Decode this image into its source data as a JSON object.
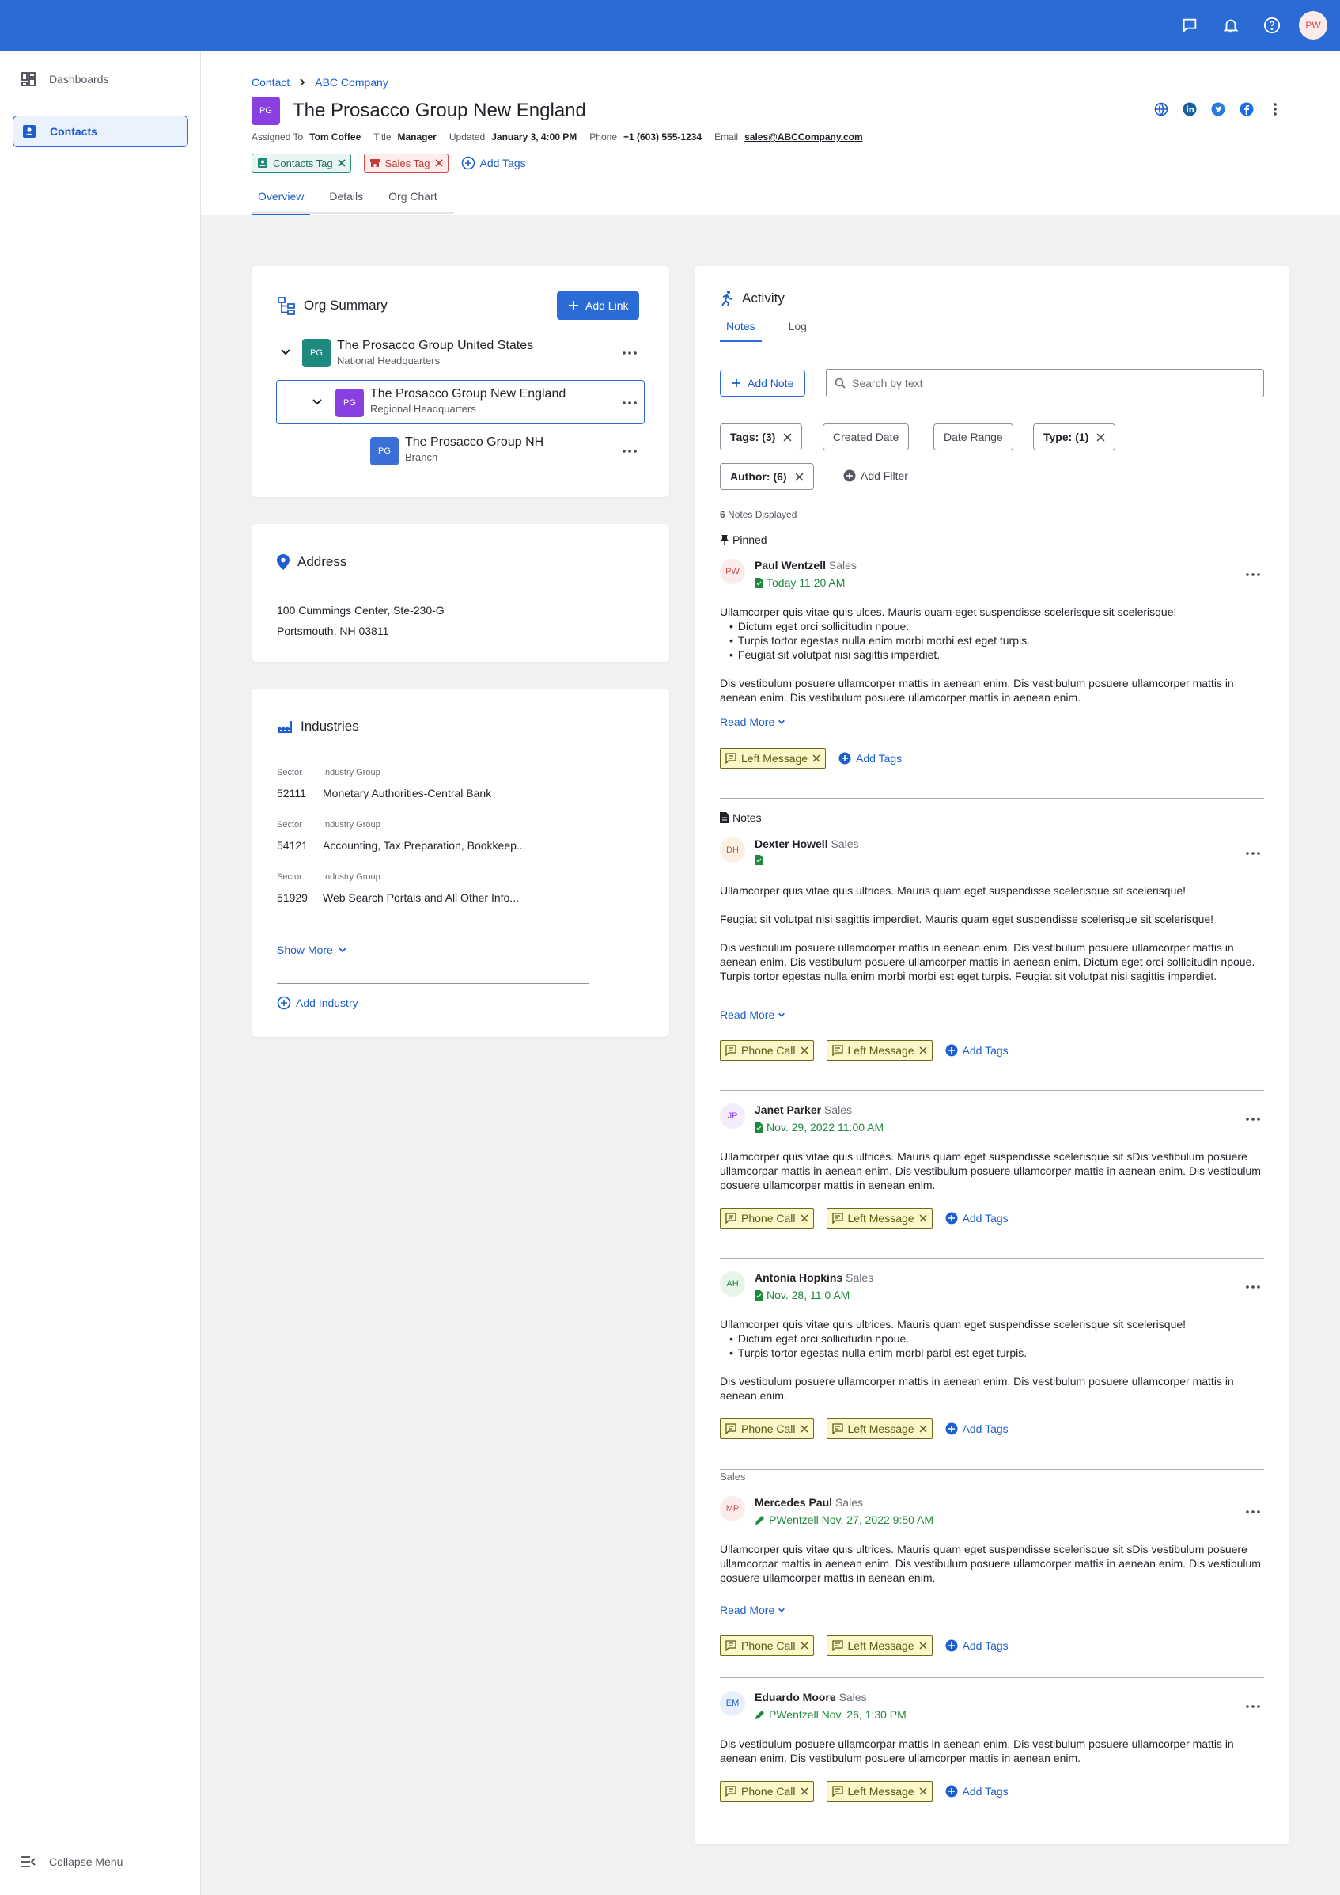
{
  "topbar": {
    "avatar_initials": "PW"
  },
  "sidebar": {
    "items": [
      {
        "label": "Dashboards"
      },
      {
        "label": "Contacts"
      }
    ],
    "collapse_label": "Collapse Menu"
  },
  "header": {
    "breadcrumb": [
      "Contact",
      "ABC Company"
    ],
    "logo_initials": "PG",
    "title": "The Prosacco Group New England",
    "meta": {
      "assigned_label": "Assigned To",
      "assigned_value": "Tom Coffee",
      "title_label": "Title",
      "title_value": "Manager",
      "updated_label": "Updated",
      "updated_value": "January 3, 4:00 PM",
      "phone_label": "Phone",
      "phone_value": "+1 (603) 555-1234",
      "email_label": "Email",
      "email_value": "sales@ABCCompany.com"
    },
    "tags": [
      "Contacts Tag",
      "Sales Tag"
    ],
    "add_tags_label": "Add Tags",
    "tabs": [
      "Overview",
      "Details",
      "Org Chart"
    ]
  },
  "org_summary": {
    "title": "Org Summary",
    "add_link_label": "Add Link",
    "rows": [
      {
        "initials": "PG",
        "name": "The Prosacco Group United States",
        "sub": "National Headquarters",
        "color": "#1e8a7d"
      },
      {
        "initials": "PG",
        "name": "The Prosacco Group New England",
        "sub": "Regional Headquarters",
        "color": "#8a3fe0"
      },
      {
        "initials": "PG",
        "name": "The Prosacco Group NH",
        "sub": "Branch",
        "color": "#3a6fd8"
      }
    ]
  },
  "address": {
    "title": "Address",
    "line1": "100 Cummings Center, Ste-230-G",
    "line2": "Portsmouth, NH 03811"
  },
  "industries": {
    "title": "Industries",
    "sector_label": "Sector",
    "group_label": "Industry Group",
    "rows": [
      {
        "sector": "52111",
        "group": "Monetary Authorities-Central Bank"
      },
      {
        "sector": "54121",
        "group": "Accounting, Tax Preparation, Bookkeep..."
      },
      {
        "sector": "51929",
        "group": "Web Search Portals and All Other Info..."
      }
    ],
    "show_more_label": "Show More",
    "add_industry_label": "Add Industry"
  },
  "activity": {
    "title": "Activity",
    "tabs": [
      "Notes",
      "Log"
    ],
    "add_note_label": "Add Note",
    "search_placeholder": "Search by text",
    "filters": {
      "tags_label": "Tags:",
      "tags_count": "(3)",
      "created_date": "Created Date",
      "date_range": "Date Range",
      "type_label": "Type:",
      "type_count": "(1)",
      "author_label": "Author:",
      "author_count": "(6)",
      "add_filter": "Add Filter"
    },
    "notes_count": "6",
    "notes_displayed": "Notes Displayed",
    "pinned_label": "Pinned",
    "notes_label": "Notes",
    "sales_label": "Sales",
    "read_more": "Read More",
    "add_tags": "Add Tags",
    "tag_phone": "Phone Call",
    "tag_left": "Left Message",
    "notes": [
      {
        "initials": "PW",
        "author": "Paul Wentzell",
        "role": "Sales",
        "when": "Today 11:20 AM",
        "p1": "Ullamcorper quis vitae quis ulces. Mauris quam eget suspendisse scelerisque sit scelerisque!",
        "bullets": [
          "Dictum eget orci sollicitudin npoue.",
          "Turpis tortor egestas nulla enim morbi morbi est eget turpis.",
          "Feugiat sit volutpat nisi sagittis imperdiet."
        ],
        "p2": "Dis vestibulum posuere ullamcorper mattis in aenean enim. Dis vestibulum posuere ullamcorper mattis in aenean enim. Dis vestibulum posuere ullamcorper mattis in aenean enim."
      },
      {
        "initials": "DH",
        "author": "Dexter Howell",
        "role": "Sales",
        "when": "",
        "p1": "Ullamcorper quis vitae quis ultrices. Mauris quam eget suspendisse scelerisque sit scelerisque!",
        "p2": "Feugiat sit volutpat nisi sagittis imperdiet.  Mauris quam eget suspendisse scelerisque sit scelerisque!",
        "p3": "Dis vestibulum posuere ullamcorper mattis in aenean enim. Dis vestibulum posuere ullamcorper mattis in aenean enim. Dis vestibulum posuere ullamcorper mattis in aenean enim. Dictum eget orci sollicitudin npoue. Turpis tortor egestas nulla enim morbi morbi est eget turpis. Feugiat sit volutpat nisi sagittis imperdiet."
      },
      {
        "initials": "JP",
        "author": "Janet Parker",
        "role": "Sales",
        "when": "Nov. 29, 2022 11:00 AM",
        "p1": "Ullamcorper quis vitae quis ultrices. Mauris quam eget suspendisse scelerisque sit sDis vestibulum posuere ullamcorpar mattis in aenean enim. Dis vestibulum posuere ullamcorper mattis in aenean enim. Dis vestibulum posuere ullamcorper mattis in aenean enim."
      },
      {
        "initials": "AH",
        "author": "Antonia Hopkins",
        "role": "Sales",
        "when": "Nov. 28, 11:0 AM",
        "p1": "Ullamcorper quis vitae quis ultrices. Mauris quam eget suspendisse scelerisque sit scelerisque!",
        "bullets": [
          "Dictum eget orci sollicitudin npoue.",
          "Turpis tortor egestas nulla enim morbi parbi est eget turpis."
        ],
        "p2": "Dis vestibulum posuere ullamcorper mattis in aenean enim. Dis vestibulum posuere ullamcorper mattis in aenean enim."
      },
      {
        "initials": "MP",
        "author": "Mercedes Paul",
        "role": "Sales",
        "when": "PWentzell Nov. 27, 2022 9:50 AM",
        "p1": "Ullamcorper quis vitae quis ultrices. Mauris quam eget suspendisse scelerisque sit sDis vestibulum posuere ullamcorpar mattis in aenean enim. Dis vestibulum posuere ullamcorper mattis in aenean enim. Dis vestibulum posuere ullamcorper mattis in aenean enim."
      },
      {
        "initials": "EM",
        "author": "Eduardo Moore",
        "role": "Sales",
        "when": "PWentzell Nov. 26, 1:30 PM",
        "p1": "Dis vestibulum posuere ullamcorpar mattis in aenean enim. Dis vestibulum posuere ullamcorper mattis in aenean enim. Dis vestibulum posuere ullamcorper mattis in aenean enim."
      }
    ]
  },
  "colors": {
    "primary": "#2a6bd6",
    "green_date": "#1e8a3e",
    "tag_yellow_bg": "#fbf7c9"
  }
}
